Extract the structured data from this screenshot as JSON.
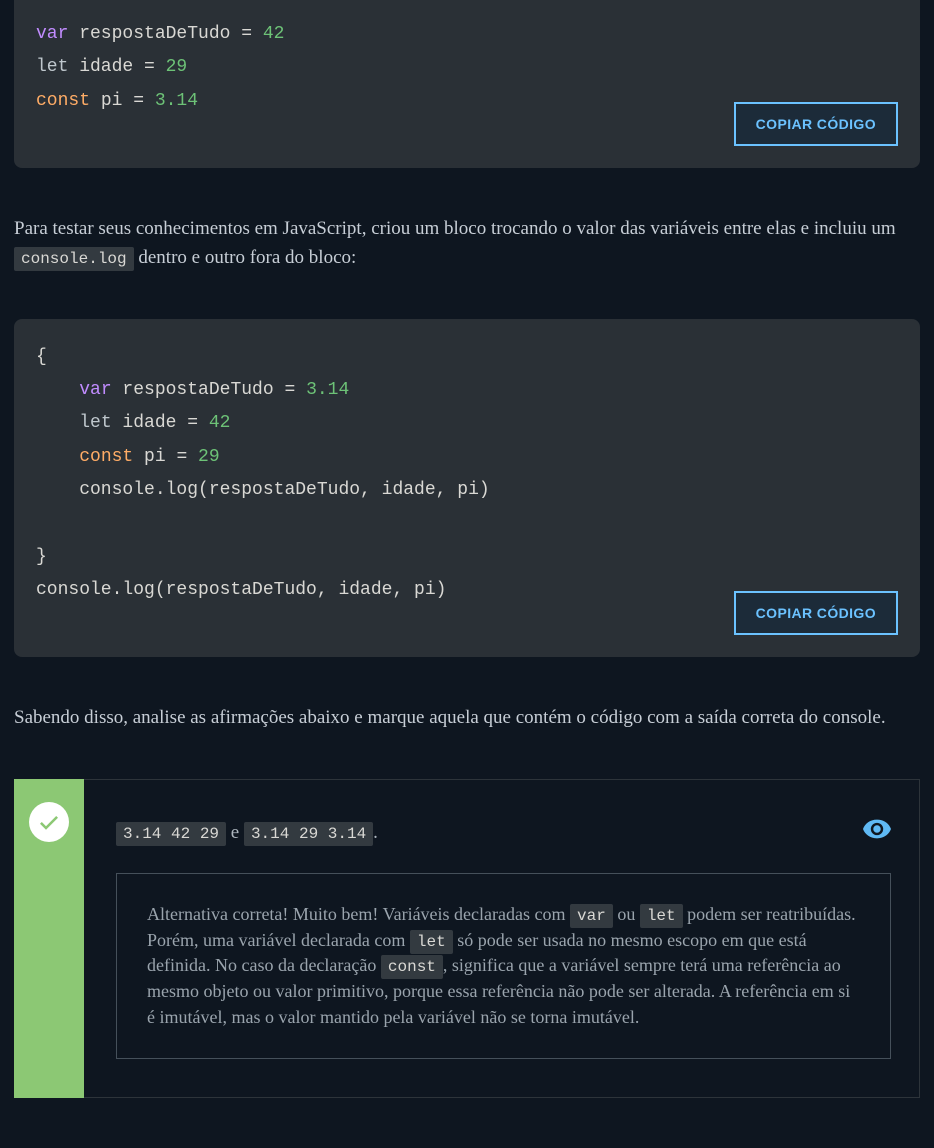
{
  "code1": {
    "l1": {
      "kw": "var",
      "rest": " respostaDeTudo = ",
      "num": "42"
    },
    "l2": {
      "kw": "let",
      "rest": " idade = ",
      "num": "29"
    },
    "l3": {
      "kw": "const",
      "rest": " pi = ",
      "num": "3.14"
    },
    "copy": "COPIAR CÓDIGO"
  },
  "para1": {
    "t1": "Para testar seus conhecimentos em JavaScript, criou um bloco trocando o valor das variáveis entre elas e incluiu um ",
    "c1": "console.log",
    "t2": " dentro e outro fora do bloco:"
  },
  "code2": {
    "open": "{",
    "l1": {
      "kw": "var",
      "rest": " respostaDeTudo = ",
      "num": "3.14"
    },
    "l2": {
      "kw": "let",
      "rest": " idade = ",
      "num": "42"
    },
    "l3": {
      "kw": "const",
      "rest": " pi = ",
      "num": "29"
    },
    "l4": "    console.log(respostaDeTudo, idade, pi)",
    "blank": "",
    "close": "}",
    "l5": "console.log(respostaDeTudo, idade, pi)",
    "indent": "    ",
    "copy": "COPIAR CÓDIGO"
  },
  "para2": "Sabendo disso, analise as afirmações abaixo e marque aquela que contém o código com a saída correta do console.",
  "answer": {
    "c1": "3.14 42 29",
    "mid": " e ",
    "c2": "3.14 29 3.14",
    "end": "."
  },
  "explain": {
    "t1": "Alternativa correta! Muito bem! Variáveis declaradas com ",
    "c1": "var",
    "t2": " ou ",
    "c2": "let",
    "t3": " podem ser reatribuídas. Porém, uma variável declarada com ",
    "c3": "let",
    "t4": " só pode ser usada no mesmo escopo em que está definida. No caso da declaração ",
    "c4": "const",
    "t5": ", significa que a variável sempre terá uma referência ao mesmo objeto ou valor primitivo, porque essa referência não pode ser alterada. A referência em si é imutável, mas o valor mantido pela variável não se torna imutável."
  }
}
